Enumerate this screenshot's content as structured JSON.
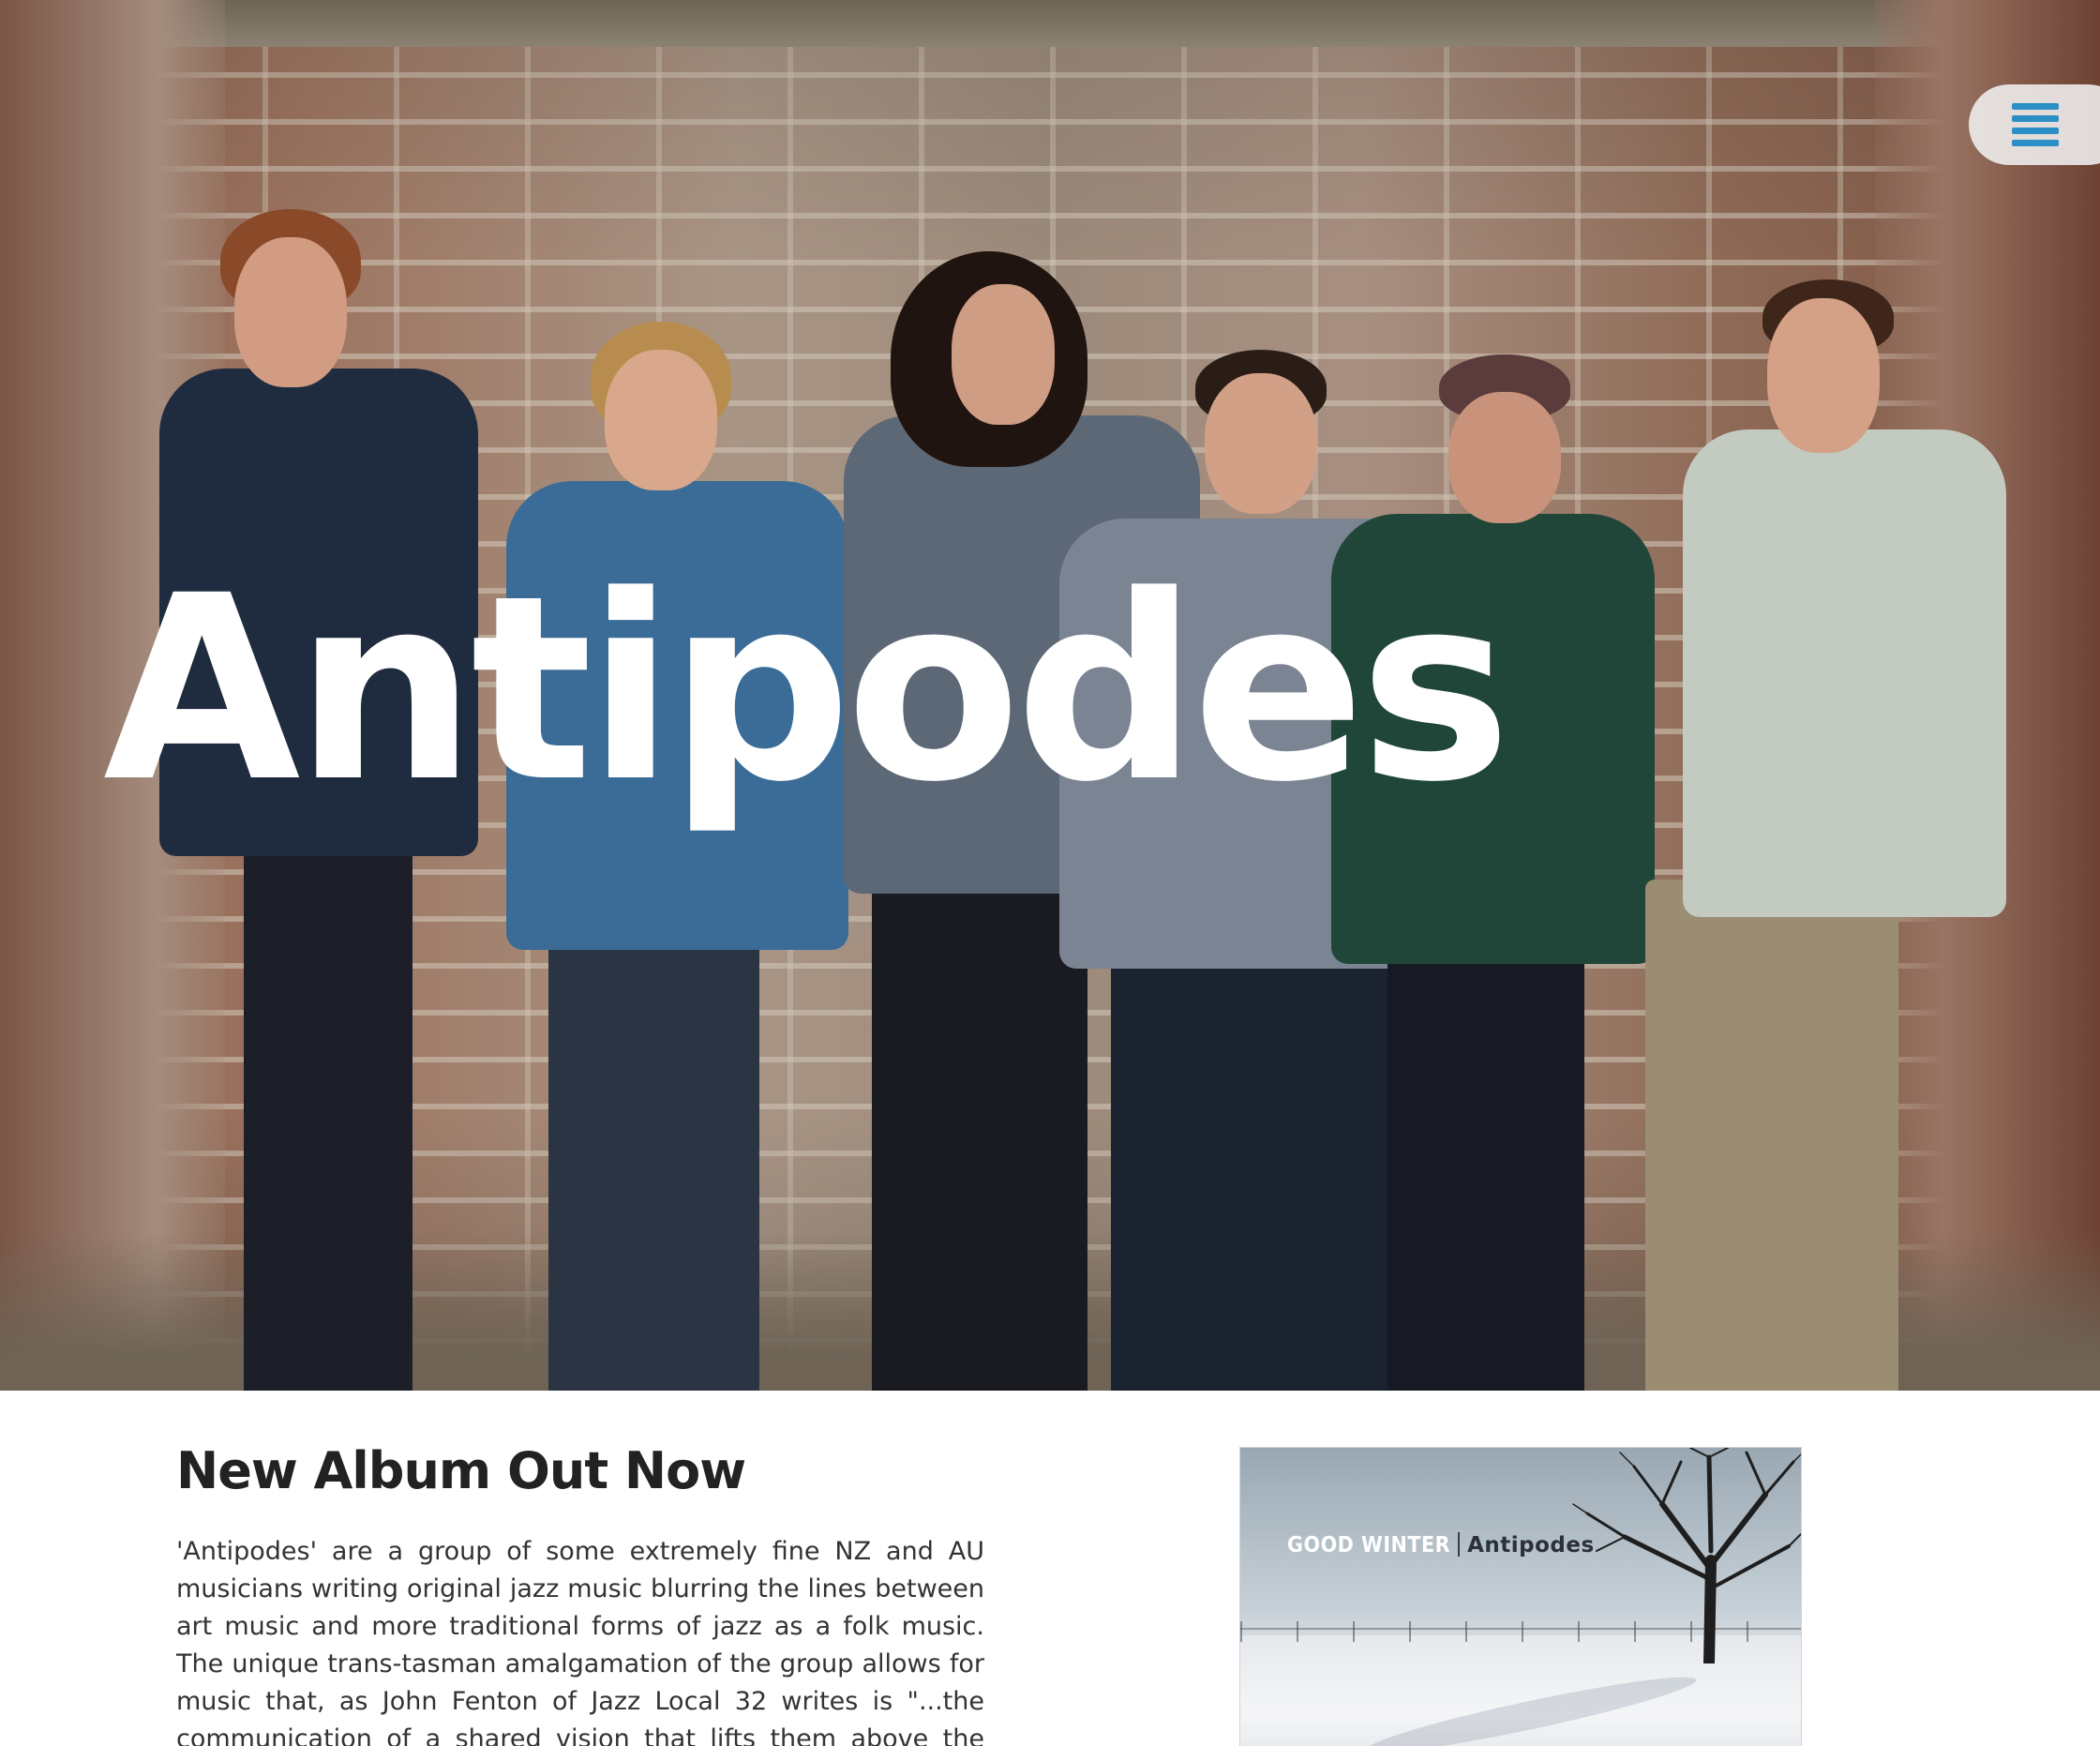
{
  "hero": {
    "title": "Antipodes",
    "menu_icon": "hamburger-menu-icon"
  },
  "album_section": {
    "heading": "New Album Out Now",
    "body": "'Antipodes' are a group of some extremely fine NZ and AU musicians writing original jazz music blurring the lines between art music and more traditional forms of jazz as a folk music. The unique trans-tasman amalgamation of the group allows for music that, as John Fenton of Jazz Local 32 writes is \"...the communication of a shared vision that lifts them above the ordinary.\""
  },
  "album_cover": {
    "artist_text": "GOOD WINTER",
    "album_text": "Antipodes"
  },
  "colors": {
    "menu_icon": "#2a8fc4",
    "heading_text": "#222222",
    "body_text": "#333333",
    "hero_title": "#ffffff"
  }
}
